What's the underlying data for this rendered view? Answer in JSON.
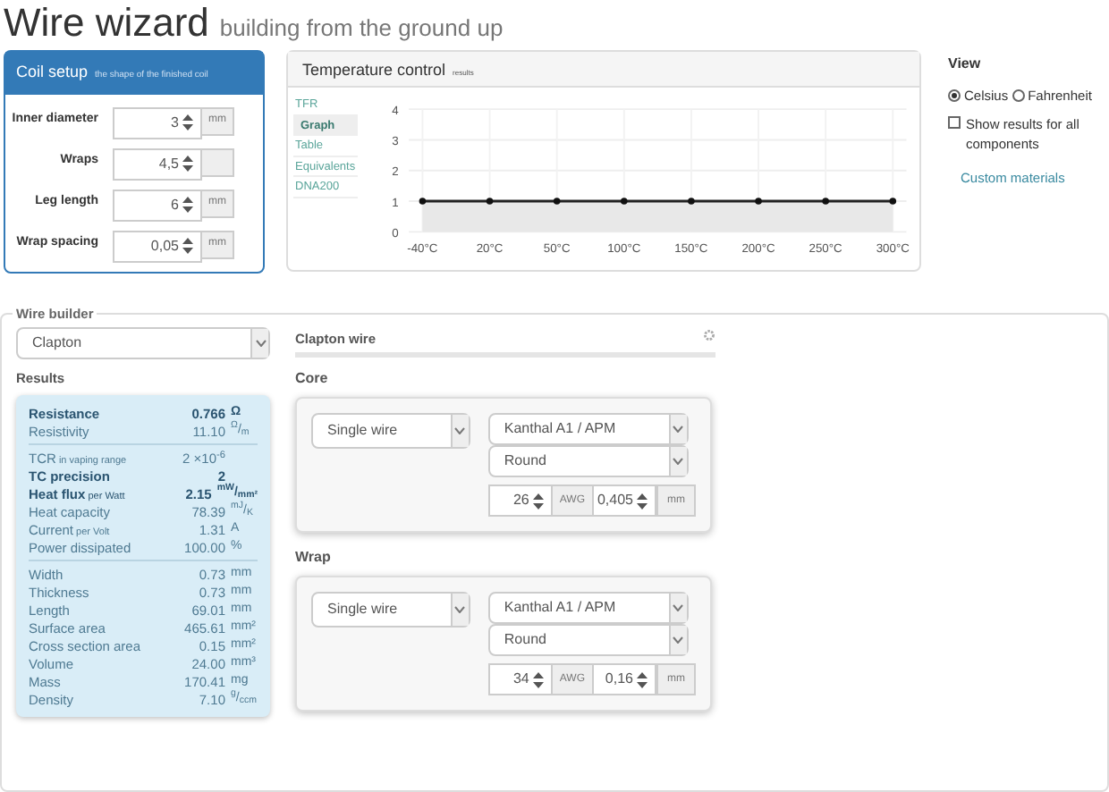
{
  "header": {
    "title": "Wire wizard",
    "subtitle": "building from the ground up"
  },
  "coil_setup": {
    "title": "Coil setup",
    "subtitle": "the shape of the finished coil",
    "fields": [
      {
        "label": "Inner diameter",
        "value": "3",
        "unit": "mm"
      },
      {
        "label": "Wraps",
        "value": "4,5"
      },
      {
        "label": "Leg length",
        "value": "6",
        "unit": "mm"
      },
      {
        "label": "Wrap spacing",
        "value": "0,05",
        "unit": "mm"
      }
    ]
  },
  "temperature_control": {
    "title": "Temperature control",
    "subtitle": "results",
    "tabs": [
      {
        "label": "TFR",
        "selected": false
      },
      {
        "label": "Graph",
        "selected": true
      },
      {
        "label": "Table",
        "selected": false
      },
      {
        "label": "Equivalents",
        "selected": false
      },
      {
        "label": "DNA200",
        "selected": false
      }
    ],
    "chart_data": {
      "type": "area",
      "categories": [
        "-40°C",
        "20°C",
        "50°C",
        "100°C",
        "150°C",
        "200°C",
        "250°C",
        "300°C"
      ],
      "values": [
        1,
        1,
        1,
        1,
        1,
        1,
        1,
        1
      ],
      "ylim": [
        0,
        4
      ],
      "yticks": [
        0,
        1,
        2,
        3,
        4
      ],
      "grid": true
    }
  },
  "view": {
    "title": "View",
    "units": [
      {
        "label": "Celsius",
        "selected": true
      },
      {
        "label": "Fahrenheit",
        "selected": false
      }
    ],
    "show_all": {
      "label": "Show results for all components",
      "checked": false
    },
    "link": "Custom materials"
  },
  "wire_builder": {
    "title": "Wire builder",
    "type": "Clapton",
    "results_title": "Results",
    "results": [
      [
        {
          "label": "Resistance",
          "value": "0.766",
          "unit": "Ω",
          "bold": true
        },
        {
          "label": "Resistivity",
          "value": "11.10",
          "unit": "$^{Ω}$/$_{m}$",
          "bold": false
        }
      ],
      [
        {
          "label": "TCR",
          "note": "in vaping range",
          "value": "2 ×10$^{-6}$",
          "bold": false
        },
        {
          "label": "TC precision",
          "value": "2",
          "bold": true
        },
        {
          "label": "Heat flux",
          "note": "per Watt",
          "value": "2.15",
          "unit": "$^{mW}$/$_{mm²}$",
          "bold": true
        },
        {
          "label": "Heat capacity",
          "value": "78.39",
          "unit": "$^{mJ}$/$_{K}$",
          "bold": false
        },
        {
          "label": "Current",
          "note": "per Volt",
          "value": "1.31",
          "unit": "A",
          "bold": false
        },
        {
          "label": "Power dissipated",
          "value": "100.00",
          "unit": "%",
          "bold": false
        }
      ],
      [
        {
          "label": "Width",
          "value": "0.73",
          "unit": "mm",
          "bold": false
        },
        {
          "label": "Thickness",
          "value": "0.73",
          "unit": "mm",
          "bold": false
        },
        {
          "label": "Length",
          "value": "69.01",
          "unit": "mm",
          "bold": false
        },
        {
          "label": "Surface area",
          "value": "465.61",
          "unit": "mm²",
          "bold": false
        },
        {
          "label": "Cross section area",
          "value": "0.15",
          "unit": "mm²",
          "bold": false
        },
        {
          "label": "Volume",
          "value": "24.00",
          "unit": "mm³",
          "bold": false
        },
        {
          "label": "Mass",
          "value": "170.41",
          "unit": "mg",
          "bold": false
        },
        {
          "label": "Density",
          "value": "7.10",
          "unit": "$^{g}$/$_{ccm}$",
          "bold": false
        }
      ]
    ],
    "wire_title": "Clapton wire",
    "components": [
      {
        "title": "Core",
        "type": "Single wire",
        "material": "Kanthal A1 / APM",
        "profile": "Round",
        "gauge": "26",
        "gauge_unit": "AWG",
        "diameter": "0,405",
        "diameter_unit": "mm"
      },
      {
        "title": "Wrap",
        "type": "Single wire",
        "material": "Kanthal A1 / APM",
        "profile": "Round",
        "gauge": "34",
        "gauge_unit": "AWG",
        "diameter": "0,16",
        "diameter_unit": "mm"
      }
    ]
  }
}
